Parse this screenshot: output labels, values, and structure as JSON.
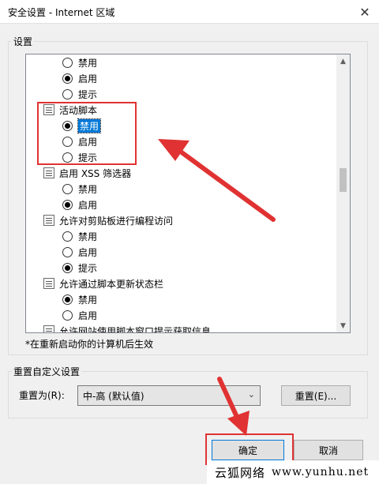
{
  "window": {
    "title": "安全设置 - Internet 区域",
    "close_glyph": "✕"
  },
  "settings_group": {
    "label": "设置"
  },
  "list": {
    "rows": [
      {
        "kind": "option",
        "label": "禁用",
        "checked": false
      },
      {
        "kind": "option",
        "label": "启用",
        "checked": true
      },
      {
        "kind": "option",
        "label": "提示",
        "checked": false
      },
      {
        "kind": "category",
        "label": "活动脚本",
        "icon": "settings-category-icon"
      },
      {
        "kind": "option",
        "label": "禁用",
        "checked": true,
        "selected": true
      },
      {
        "kind": "option",
        "label": "启用",
        "checked": false
      },
      {
        "kind": "option",
        "label": "提示",
        "checked": false
      },
      {
        "kind": "category",
        "label": "启用 XSS 筛选器",
        "icon": "settings-category-icon"
      },
      {
        "kind": "option",
        "label": "禁用",
        "checked": false
      },
      {
        "kind": "option",
        "label": "启用",
        "checked": true
      },
      {
        "kind": "category",
        "label": "允许对剪贴板进行编程访问",
        "icon": "settings-category-icon"
      },
      {
        "kind": "option",
        "label": "禁用",
        "checked": false
      },
      {
        "kind": "option",
        "label": "启用",
        "checked": false
      },
      {
        "kind": "option",
        "label": "提示",
        "checked": true
      },
      {
        "kind": "category",
        "label": "允许通过脚本更新状态栏",
        "icon": "settings-category-icon"
      },
      {
        "kind": "option",
        "label": "禁用",
        "checked": true
      },
      {
        "kind": "option",
        "label": "启用",
        "checked": false
      },
      {
        "kind": "category",
        "label": "允许网站使用脚本窗口提示获取信息",
        "icon": "settings-category-icon"
      }
    ],
    "scroll_up_glyph": "▲",
    "scroll_down_glyph": "▼"
  },
  "note": "*在重新启动你的计算机后生效",
  "reset_group": {
    "label": "重置自定义设置",
    "reset_to_label": "重置为(R):",
    "level_value": "中-高 (默认值)",
    "chevron_glyph": "⌄",
    "reset_button": "重置(E)..."
  },
  "buttons": {
    "ok": "确定",
    "cancel": "取消"
  },
  "watermark": {
    "brand": "云狐网络",
    "site": "www.yunhu.net"
  },
  "colors": {
    "annotation_red": "#e03232",
    "selection_blue": "#0078d7"
  }
}
